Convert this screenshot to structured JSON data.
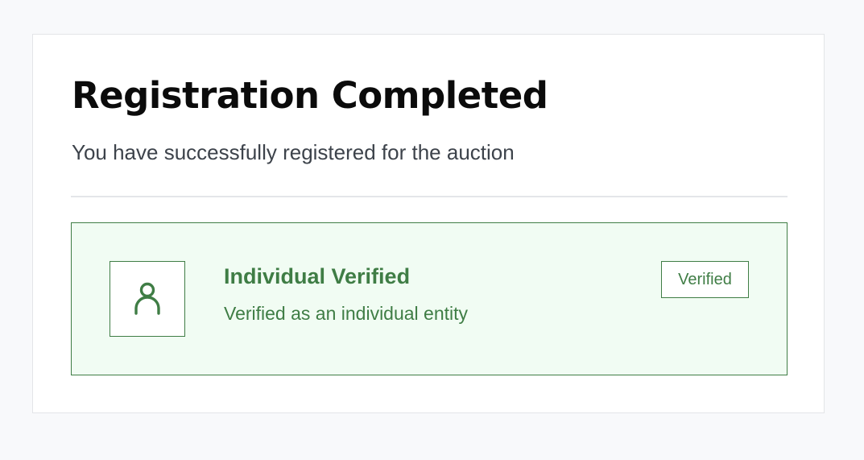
{
  "header": {
    "title": "Registration Completed",
    "subtitle": "You have successfully registered for the auction"
  },
  "verification": {
    "icon": "user-icon",
    "title": "Individual Verified",
    "description": "Verified as an individual entity",
    "badge": "Verified"
  },
  "colors": {
    "page_background": "#f8f9fb",
    "card_background": "#ffffff",
    "success_green": "#3f7d45",
    "success_background": "#f1fcf3",
    "title_text": "#0b0b0b",
    "subtitle_text": "#3d434b"
  }
}
